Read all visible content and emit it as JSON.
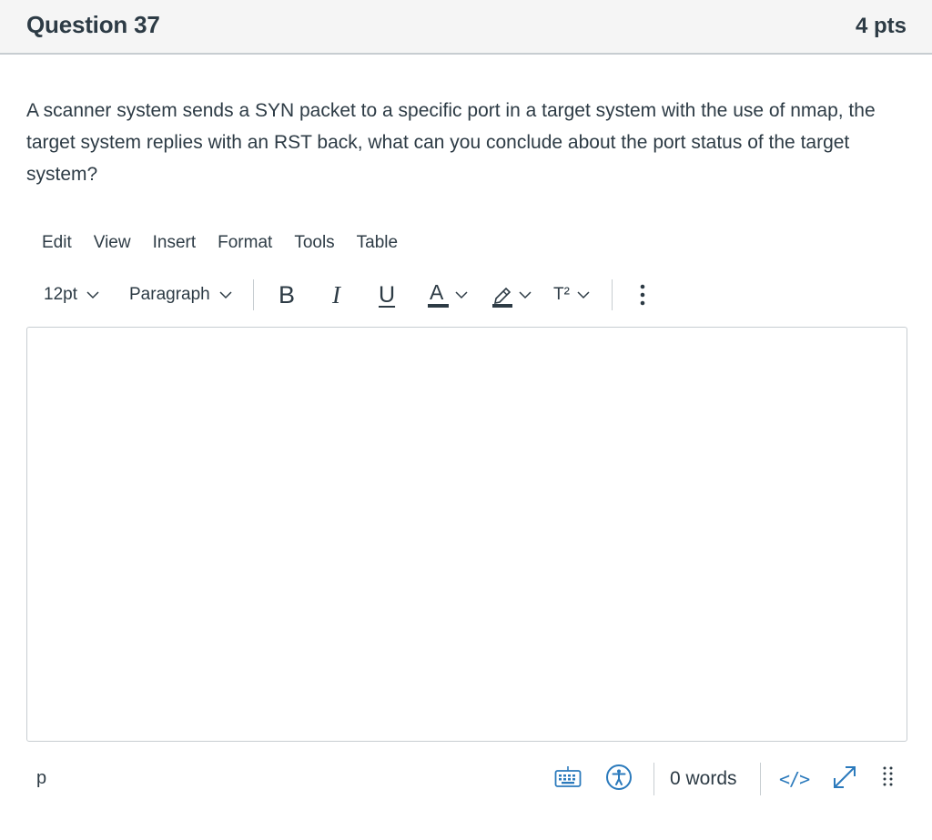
{
  "question": {
    "title": "Question 37",
    "points": "4 pts",
    "text": "A scanner system sends a SYN packet to a specific port in a target system with the use of nmap, the target system replies with an RST back, what can you conclude about the port status of the target system?"
  },
  "editor": {
    "menubar": [
      "Edit",
      "View",
      "Insert",
      "Format",
      "Tools",
      "Table"
    ],
    "toolbar": {
      "font_size": "12pt",
      "block_format": "Paragraph",
      "bold": "B",
      "italic": "I",
      "underline": "U",
      "text_color": "A",
      "superscript": "T²",
      "more_icon": "vertical-ellipsis-icon"
    },
    "content": "",
    "statusbar": {
      "path": "p",
      "word_count": "0 words",
      "html_toggle": "</>",
      "keyboard_icon": "keyboard-icon",
      "accessibility_icon": "accessibility-icon",
      "fullscreen_icon": "expand-icon",
      "resize_icon": "resize-handle-icon"
    }
  },
  "colors": {
    "text": "#2d3b45",
    "accent": "#2b7abc",
    "border": "#c7cdd1",
    "header_bg": "#f5f5f5"
  }
}
